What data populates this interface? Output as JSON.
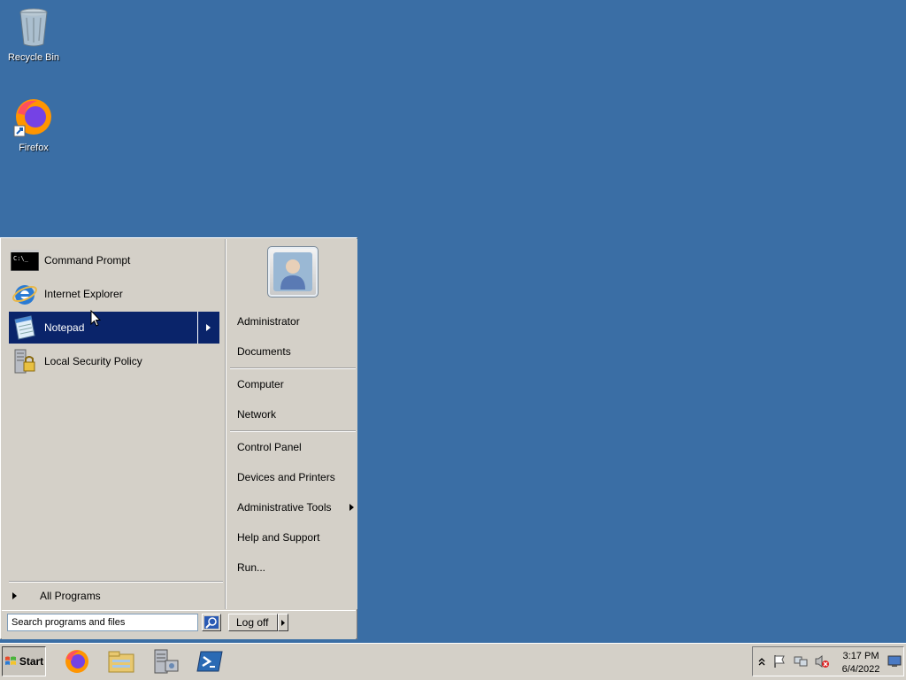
{
  "desktop": {
    "icons": [
      {
        "label": "Recycle Bin",
        "icon": "recycle-bin-icon"
      },
      {
        "label": "Firefox",
        "icon": "firefox-icon"
      }
    ],
    "background_color": "#3a6ea5"
  },
  "start_menu": {
    "programs": [
      {
        "label": "Command Prompt",
        "icon": "command-prompt-icon"
      },
      {
        "label": "Internet Explorer",
        "icon": "internet-explorer-icon"
      },
      {
        "label": "Notepad",
        "icon": "notepad-icon",
        "selected": true
      },
      {
        "label": "Local Security Policy",
        "icon": "security-policy-icon"
      }
    ],
    "all_programs": "All Programs",
    "right_items": {
      "user": "Administrator",
      "documents": "Documents",
      "computer": "Computer",
      "network": "Network",
      "control_panel": "Control Panel",
      "devices": "Devices and Printers",
      "admin_tools": "Administrative Tools",
      "help": "Help and Support",
      "run": "Run..."
    },
    "search": {
      "value": "Search programs and files"
    },
    "log_off": "Log off",
    "selection_color": "#0a246a"
  },
  "taskbar": {
    "start_label": "Start",
    "pinned": [
      "firefox-icon",
      "file-explorer-icon",
      "server-manager-icon",
      "powershell-icon"
    ],
    "clock": {
      "time": "3:17 PM",
      "date": "6/4/2022"
    }
  }
}
